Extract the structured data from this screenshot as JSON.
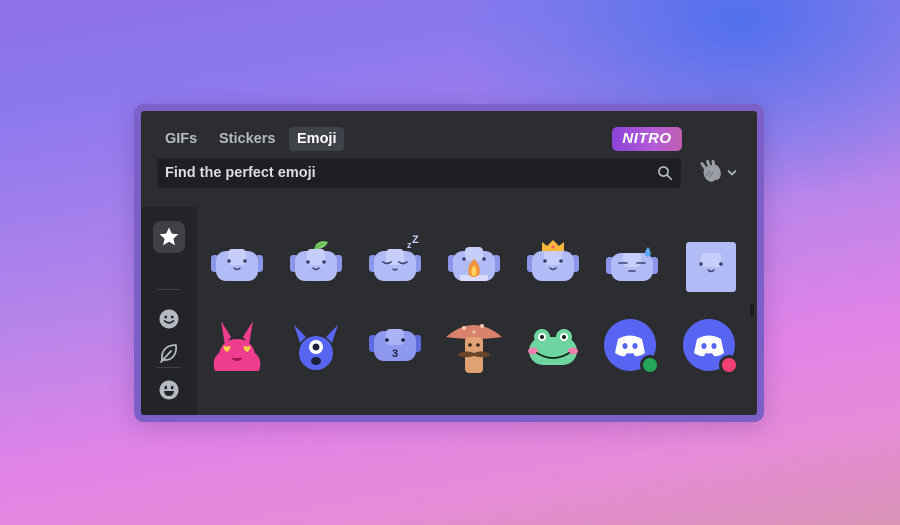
{
  "tabs": [
    "GIFs",
    "Stickers",
    "Emoji"
  ],
  "active_tab": "Emoji",
  "nitro_badge": "NITRO",
  "search": {
    "placeholder": "Find the perfect emoji"
  },
  "skin_tone_selector": {
    "icon": "clapping-hands-icon",
    "dropdown_icon": "chevron-down-icon"
  },
  "sidebar": {
    "categories": [
      {
        "name": "favorites",
        "icon": "star-icon",
        "selected": true
      },
      {
        "name": "people",
        "icon": "smiley-face-icon",
        "selected": false
      },
      {
        "name": "nature",
        "icon": "leaf-icon",
        "selected": false
      },
      {
        "name": "custom",
        "icon": "grinning-face-icon",
        "selected": false
      }
    ]
  },
  "emoji_rows": [
    [
      "wumpus-face-emoji",
      "wumpus-with-leaf-emoji",
      "sleepy-wumpus-emoji",
      "wumpus-with-flame-emoji",
      "crowned-wumpus-emoji",
      "sweating-wumpus-emoji",
      "square-wumpus-emoji"
    ],
    [
      "pink-bunny-heart-eyes-emoji",
      "blue-cyclops-monster-emoji",
      "wumpus-kiss-emoji",
      "mushroom-mustache-emoji",
      "frog-face-emoji",
      "discord-logo-online-emoji",
      "discord-logo-dnd-emoji"
    ]
  ],
  "colors": {
    "panel_bg": "#2b2d31",
    "search_bg": "#1e1f22",
    "sidebar_bg": "#232428",
    "blurple": "#5865f2",
    "wumpus_light": "#b1bbf5",
    "status_online": "#23a55a",
    "status_dnd": "#f23f43"
  }
}
